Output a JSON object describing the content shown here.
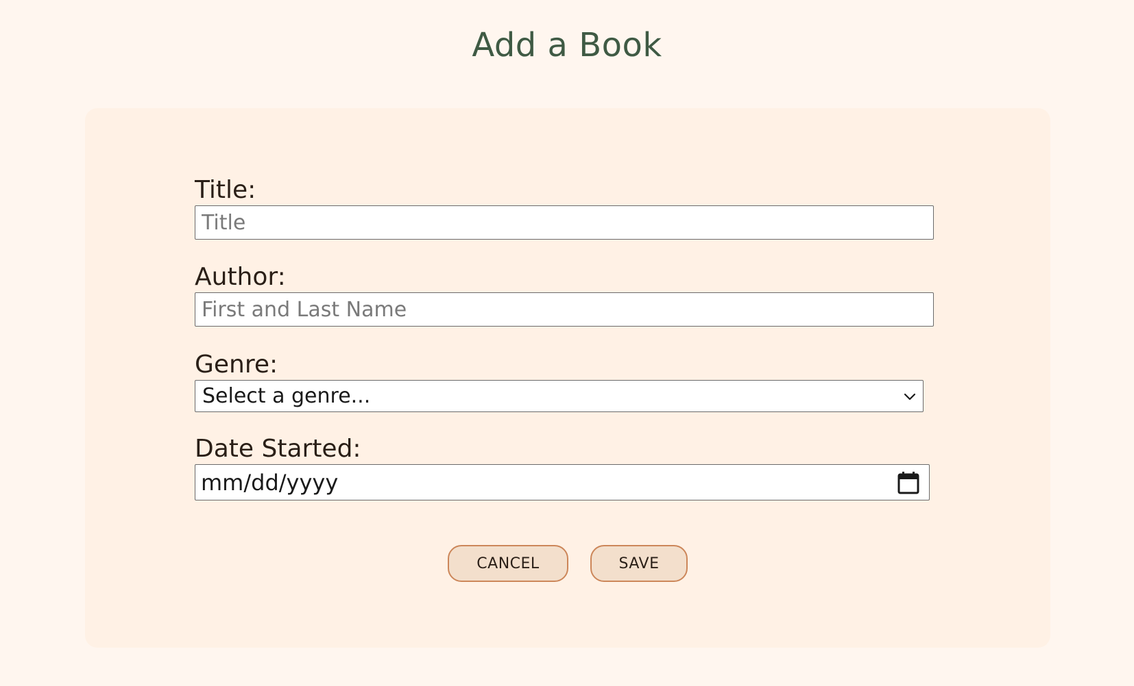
{
  "page": {
    "title": "Add a Book"
  },
  "form": {
    "title_field": {
      "label": "Title:",
      "placeholder": "Title",
      "value": ""
    },
    "author_field": {
      "label": "Author:",
      "placeholder": "First and Last Name",
      "value": ""
    },
    "genre_field": {
      "label": "Genre:",
      "selected": "Select a genre..."
    },
    "date_field": {
      "label": "Date Started:",
      "value": "mm/dd/yyyy"
    },
    "buttons": {
      "cancel": "CANCEL",
      "save": "SAVE"
    }
  },
  "icons": {
    "select_arrow": "chevron-down-icon",
    "date_picker": "calendar-icon"
  },
  "colors": {
    "page_background": "#fff6ef",
    "card_background": "#fff1e5",
    "title_color": "#3f5a44",
    "button_fill": "#f3dfcc",
    "button_border": "#cc8659"
  }
}
